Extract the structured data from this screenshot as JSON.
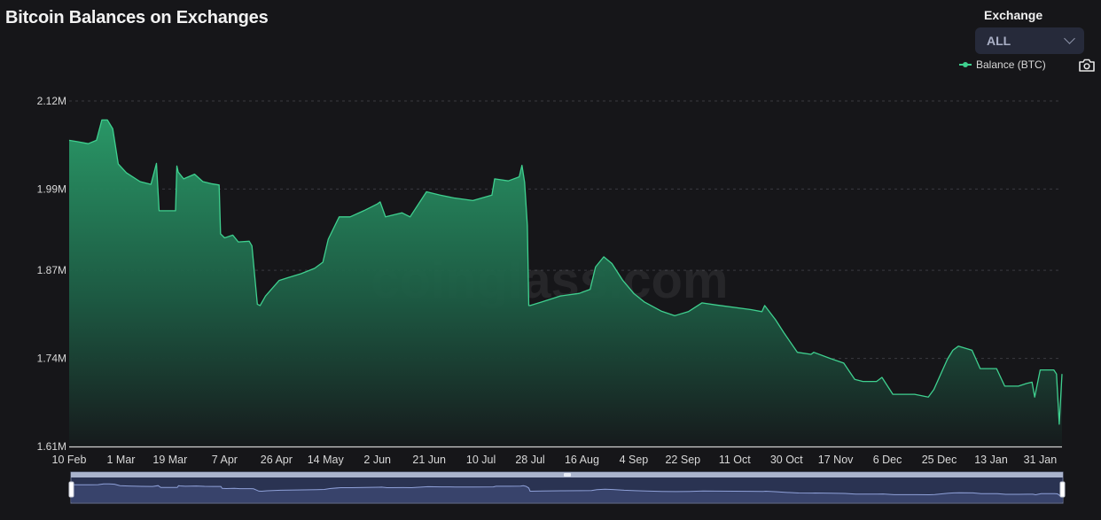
{
  "header": {
    "title": "Bitcoin Balances on Exchanges"
  },
  "filters": {
    "exchange_label": "Exchange",
    "exchange_selected": "ALL",
    "exchange_icon": "chevron-down-icon"
  },
  "toolbar": {
    "screenshot_icon": "camera-icon"
  },
  "watermark": "coinglass.com",
  "colors": {
    "background": "#161619",
    "line": "#3fd08f",
    "area_top": "#2a9d6a",
    "area_bottom": "#161a1c",
    "grid": "#3a3a40",
    "slider_fill": "#3b4670",
    "slider_line": "#8ea0d8"
  },
  "chart_data": {
    "type": "area",
    "title": "Bitcoin Balances on Exchanges",
    "xlabel": "",
    "ylabel": "",
    "legend": [
      {
        "name": "Balance (BTC)",
        "color": "#3fd08f"
      }
    ],
    "legend_position": "top-right",
    "grid": true,
    "ylim": [
      1.61,
      2.12
    ],
    "y_unit": "M",
    "y_ticks": [
      "1.61M",
      "1.74M",
      "1.87M",
      "1.99M",
      "2.12M"
    ],
    "y_tick_values": [
      1.61,
      1.74,
      1.87,
      1.99,
      2.12
    ],
    "x_ticks": [
      "10 Feb",
      "1 Mar",
      "19 Mar",
      "7 Apr",
      "26 Apr",
      "14 May",
      "2 Jun",
      "21 Jun",
      "10 Jul",
      "28 Jul",
      "16 Aug",
      "4 Sep",
      "22 Sep",
      "11 Oct",
      "30 Oct",
      "17 Nov",
      "6 Dec",
      "25 Dec",
      "13 Jan",
      "31 Jan"
    ],
    "x_tick_days": [
      0,
      19,
      37,
      57,
      76,
      94,
      113,
      132,
      151,
      169,
      188,
      207,
      225,
      244,
      263,
      281,
      300,
      319,
      338,
      356
    ],
    "x_range_days": [
      0,
      364
    ],
    "series": [
      {
        "name": "Balance (BTC)",
        "unit": "million BTC",
        "days": [
          0,
          3,
          7,
          10,
          12,
          14,
          16,
          18,
          21,
          26,
          30,
          32,
          33,
          39,
          39.5,
          40,
          42,
          46,
          49,
          52,
          55,
          55.5,
          57,
          60,
          62,
          66,
          67,
          69,
          70,
          72,
          77,
          80,
          85,
          90,
          93,
          95,
          99,
          103,
          108,
          113,
          114,
          116,
          122,
          125,
          131,
          136,
          141,
          148,
          155,
          156,
          161,
          165,
          166,
          167,
          168,
          168.5,
          169,
          173,
          180,
          187,
          191,
          193,
          196,
          199,
          203,
          207,
          211,
          217,
          222,
          227,
          232,
          237,
          250,
          254,
          255,
          259,
          262,
          267,
          272,
          273,
          279,
          284,
          288,
          291,
          296,
          298,
          302,
          310,
          315,
          317,
          322,
          324,
          326,
          331,
          334,
          340,
          343,
          348,
          351,
          353,
          354,
          356,
          361,
          362,
          363,
          364
        ],
        "values": [
          2.062,
          2.06,
          2.057,
          2.062,
          2.092,
          2.092,
          2.079,
          2.027,
          2.014,
          2.001,
          1.997,
          2.028,
          1.958,
          1.958,
          2.024,
          2.015,
          2.005,
          2.012,
          2.001,
          1.998,
          1.996,
          1.924,
          1.918,
          1.922,
          1.912,
          1.913,
          1.906,
          1.82,
          1.818,
          1.832,
          1.855,
          1.859,
          1.865,
          1.873,
          1.882,
          1.916,
          1.949,
          1.949,
          1.958,
          1.968,
          1.971,
          1.949,
          1.955,
          1.949,
          1.986,
          1.981,
          1.977,
          1.973,
          1.981,
          2.005,
          2.002,
          2.008,
          2.025,
          2.0,
          1.936,
          1.818,
          1.818,
          1.823,
          1.832,
          1.836,
          1.842,
          1.875,
          1.89,
          1.88,
          1.855,
          1.836,
          1.823,
          1.81,
          1.803,
          1.809,
          1.822,
          1.819,
          1.812,
          1.809,
          1.818,
          1.797,
          1.778,
          1.749,
          1.746,
          1.749,
          1.74,
          1.733,
          1.709,
          1.706,
          1.706,
          1.712,
          1.687,
          1.687,
          1.683,
          1.694,
          1.739,
          1.752,
          1.758,
          1.752,
          1.725,
          1.725,
          1.699,
          1.699,
          1.703,
          1.705,
          1.683,
          1.723,
          1.723,
          1.717,
          1.643,
          1.717,
          1.715
        ]
      }
    ],
    "data_zoom": {
      "start_percent": 0,
      "end_percent": 100
    }
  }
}
